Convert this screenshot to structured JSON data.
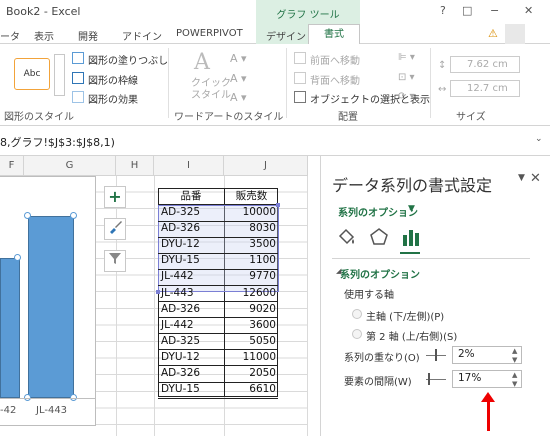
{
  "window": {
    "title": "Book2 - Excel",
    "help": "?",
    "restore": "□",
    "minimize": "−",
    "close": "✕"
  },
  "chart_tools": {
    "label": "グラフ ツール"
  },
  "tabs": {
    "data": "ータ",
    "view": "表示",
    "dev": "開発",
    "addin": "アドイン",
    "powerpivot": "POWERPIVOT",
    "design": "デザイン",
    "format": "書式"
  },
  "ribbon": {
    "abc_label": "Abc",
    "shape_fill": "図形の塗りつぶし",
    "shape_outline": "図形の枠線",
    "shape_effects": "図形の効果",
    "shape_styles_group": "図形のスタイル",
    "quick_style": "クイック\nスタイル",
    "wordart_group": "ワードアートのスタイル",
    "bring_forward": "前面へ移動",
    "send_backward": "背面へ移動",
    "selection_pane": "オブジェクトの選択と表示",
    "arrange_group": "配置",
    "height_value": "7.62 cm",
    "width_value": "12.7 cm",
    "size_group": "サイズ"
  },
  "formula": {
    "text": "8,グラフ!$J$3:$J$8,1)"
  },
  "columns": {
    "F": "F",
    "G": "G",
    "H": "H",
    "I": "I",
    "J": "J"
  },
  "chart": {
    "x_labels": [
      "-42",
      "JL-443"
    ],
    "colors": {
      "bar": "#5b9bd5"
    }
  },
  "chart_buttons": {
    "add": "+",
    "style": "brush-icon",
    "filter": "filter-icon"
  },
  "table": {
    "headers": [
      "品番",
      "販売数"
    ],
    "rows": [
      [
        "AD-325",
        "10000"
      ],
      [
        "AD-326",
        "8030"
      ],
      [
        "DYU-12",
        "3500"
      ],
      [
        "DYU-15",
        "1100"
      ],
      [
        "JL-442",
        "9770"
      ],
      [
        "JL-443",
        "12600"
      ],
      [
        "AD-326",
        "9020"
      ],
      [
        "JL-442",
        "3600"
      ],
      [
        "AD-325",
        "5050"
      ],
      [
        "DYU-12",
        "11000"
      ],
      [
        "AD-326",
        "2050"
      ],
      [
        "DYU-15",
        "6610"
      ]
    ]
  },
  "pane": {
    "title": "データ系列の書式設定",
    "dropdown_arrow": "▼",
    "close": "✕",
    "series_options_tab": "系列のオプション",
    "section": "系列のオプション",
    "axis_label": "使用する軸",
    "primary_axis": "主軸 (下/左側)(P)",
    "secondary_axis": "第 2 軸 (上/右側)(S)",
    "overlap_label": "系列の重なり(O)",
    "overlap_value": "2%",
    "gap_label": "要素の間隔(W)",
    "gap_value": "17%"
  },
  "accent_colors": {
    "excel_green": "#217346",
    "annotation_red": "#e00000"
  }
}
